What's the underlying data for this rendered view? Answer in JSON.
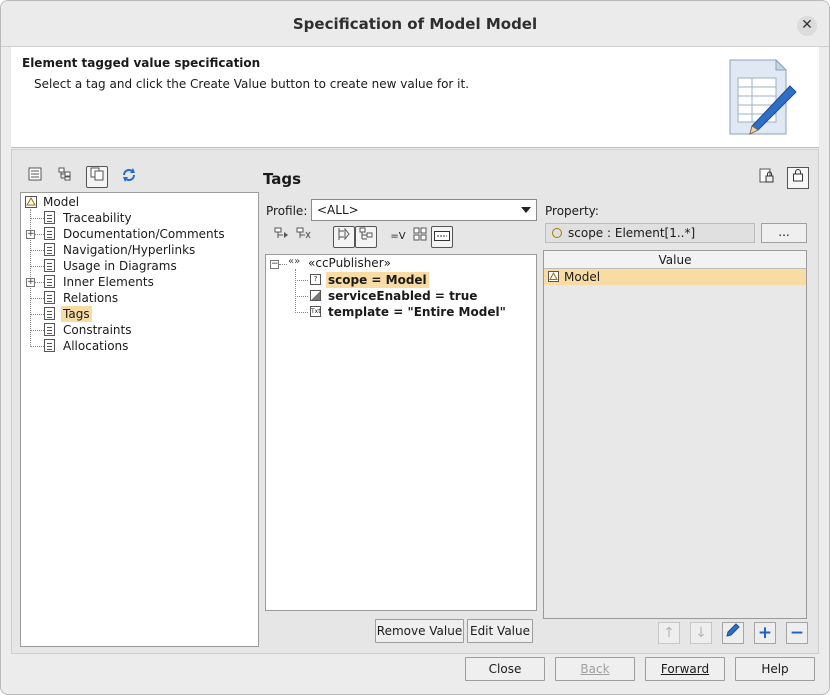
{
  "window": {
    "title": "Specification of Model Model"
  },
  "header": {
    "title": "Element tagged value specification",
    "description": "Select a tag and click the Create Value button to create new value for it."
  },
  "tree": {
    "root": "Model",
    "items": [
      {
        "label": "Traceability"
      },
      {
        "label": "Documentation/Comments"
      },
      {
        "label": "Navigation/Hyperlinks"
      },
      {
        "label": "Usage in Diagrams"
      },
      {
        "label": "Inner Elements"
      },
      {
        "label": "Relations"
      },
      {
        "label": "Tags"
      },
      {
        "label": "Constraints"
      },
      {
        "label": "Allocations"
      }
    ]
  },
  "tags": {
    "title": "Tags",
    "profile_label": "Profile:",
    "profile_value": "<ALL>",
    "stereotype": "«ccPublisher»",
    "stereotype_icon_text": "«»",
    "entries": [
      {
        "label": "scope = Model"
      },
      {
        "label": "serviceEnabled = true"
      },
      {
        "label": "template = \"Entire Model\""
      }
    ],
    "remove_value": "Remove Value",
    "edit_value": "Edit Value"
  },
  "property": {
    "label": "Property:",
    "value": "scope : Element[1..*]",
    "ellipsis": "...",
    "column_header": "Value",
    "rows": [
      "Model"
    ]
  },
  "footer": {
    "close": "Close",
    "back": "Back",
    "forward": "Forward",
    "help": "Help"
  },
  "icons": {
    "close": "close-icon",
    "accent_color": "#1f63c4",
    "selection_color": "#f8dca4"
  }
}
